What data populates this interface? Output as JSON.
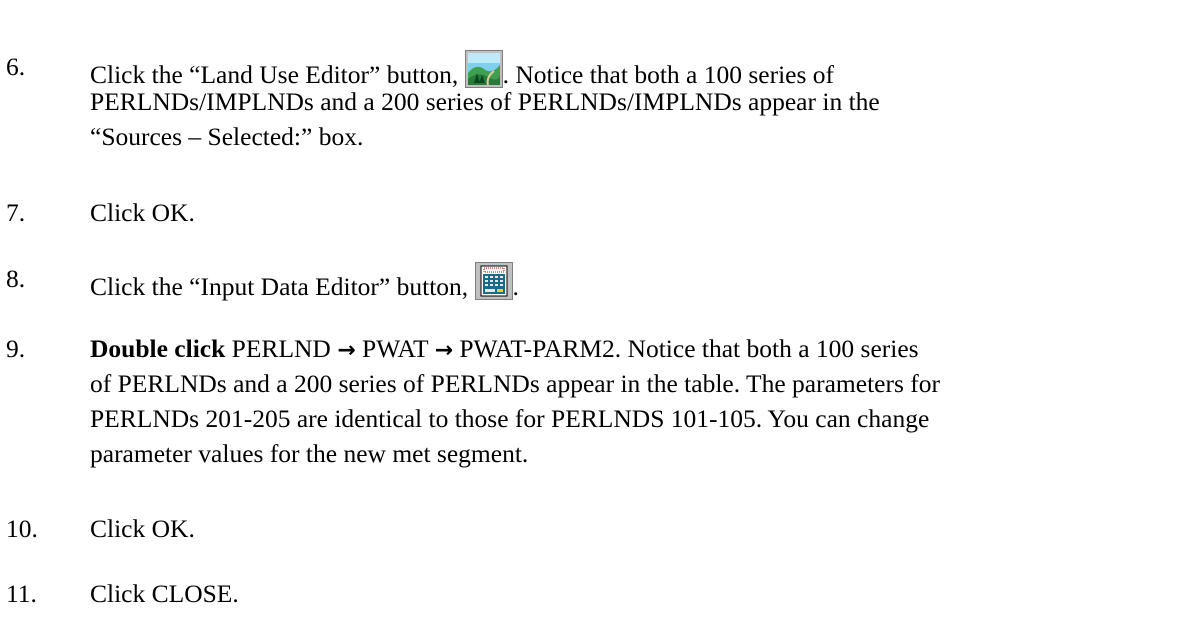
{
  "steps": [
    {
      "number": "6.",
      "line1_before": "Click the “Land Use Editor” button, ",
      "line1_after": ".  Notice that both a 100 series of",
      "line2": "PERLNDs/IMPLNDs and a 200 series of PERLNDs/IMPLNDs appear in the",
      "line3": "“Sources – Selected:” box.",
      "icon": "land-use-editor-icon"
    },
    {
      "number": "7.",
      "text": "Click OK."
    },
    {
      "number": "8.",
      "text_before": "Click the “Input Data Editor” button, ",
      "text_after": ".",
      "icon": "input-data-editor-icon"
    },
    {
      "number": "9.",
      "bold": "Double click",
      "path_1": " PERLND ",
      "arrow": "→",
      "path_2": " PWAT ",
      "path_3": " PWAT-PARM2.  Notice that both a 100 series",
      "line2": "of PERLNDs and a 200 series of PERLNDs appear in the table.  The parameters for",
      "line3": "PERLNDs 201-205 are identical to those for PERLNDS 101-105. You can change",
      "line4": "parameter values for the new met segment."
    },
    {
      "number": "10.",
      "text": "Click OK."
    },
    {
      "number": "11.",
      "text": "Click CLOSE."
    }
  ]
}
